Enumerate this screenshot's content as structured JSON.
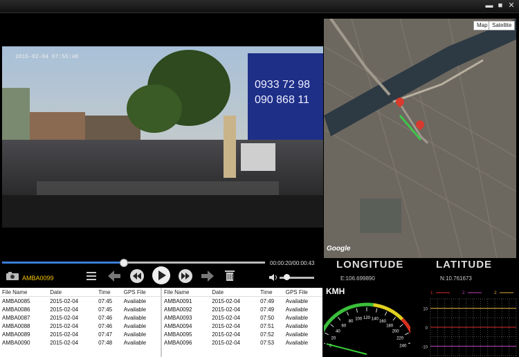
{
  "window": {
    "minimize_glyph": "▬",
    "maximize_glyph": "■",
    "close_glyph": "✕"
  },
  "video": {
    "timestamp": "2015-02-04 07:55:40"
  },
  "map": {
    "map_button": "Map",
    "satellite_button": "Satellite",
    "google_label": "Google",
    "longitude_header": "LONGITUDE",
    "latitude_header": "LATITUDE",
    "longitude_value": "E:106.699890",
    "latitude_value": "N:10.761673"
  },
  "player": {
    "progress": 0.46,
    "time_display": "00:00:20/00:00:43",
    "current_file": "AMBA0099",
    "volume": 0.2,
    "icons": [
      "camera-icon",
      "list-icon",
      "back-arrow-icon",
      "previous-icon",
      "play-icon",
      "next-icon",
      "forward-arrow-icon",
      "trash-icon",
      "speaker-icon"
    ]
  },
  "files": {
    "headers": [
      "File Name",
      "Date",
      "Time",
      "GPS File"
    ],
    "left": [
      [
        "AMBA0085",
        "2015-02-04",
        "07:45",
        "Available"
      ],
      [
        "AMBA0086",
        "2015-02-04",
        "07:45",
        "Available"
      ],
      [
        "AMBA0087",
        "2015-02-04",
        "07:46",
        "Available"
      ],
      [
        "AMBA0088",
        "2015-02-04",
        "07:46",
        "Available"
      ],
      [
        "AMBA0089",
        "2015-02-04",
        "07:47",
        "Available"
      ],
      [
        "AMBA0090",
        "2015-02-04",
        "07:48",
        "Available"
      ]
    ],
    "right": [
      [
        "AMBA0091",
        "2015-02-04",
        "07:49",
        "Available"
      ],
      [
        "AMBA0092",
        "2015-02-04",
        "07:49",
        "Available"
      ],
      [
        "AMBA0093",
        "2015-02-04",
        "07:50",
        "Available"
      ],
      [
        "AMBA0094",
        "2015-02-04",
        "07:51",
        "Available"
      ],
      [
        "AMBA0095",
        "2015-02-04",
        "07:52",
        "Available"
      ],
      [
        "AMBA0096",
        "2015-02-04",
        "07:53",
        "Available"
      ]
    ]
  },
  "speedometer": {
    "unit": "KMH",
    "ticks": [
      "0",
      "20",
      "40",
      "60",
      "80",
      "100",
      "120",
      "140",
      "160",
      "180",
      "200",
      "220",
      "240"
    ],
    "speed": 0
  },
  "graph": {
    "plus": "+",
    "minus": "−",
    "legend": [
      "1:",
      "2:",
      "2:"
    ],
    "legend_colors": [
      "#e03030",
      "#c040c0",
      "#e0b040"
    ],
    "y_ticks": [
      "10",
      "0",
      "-10"
    ]
  }
}
